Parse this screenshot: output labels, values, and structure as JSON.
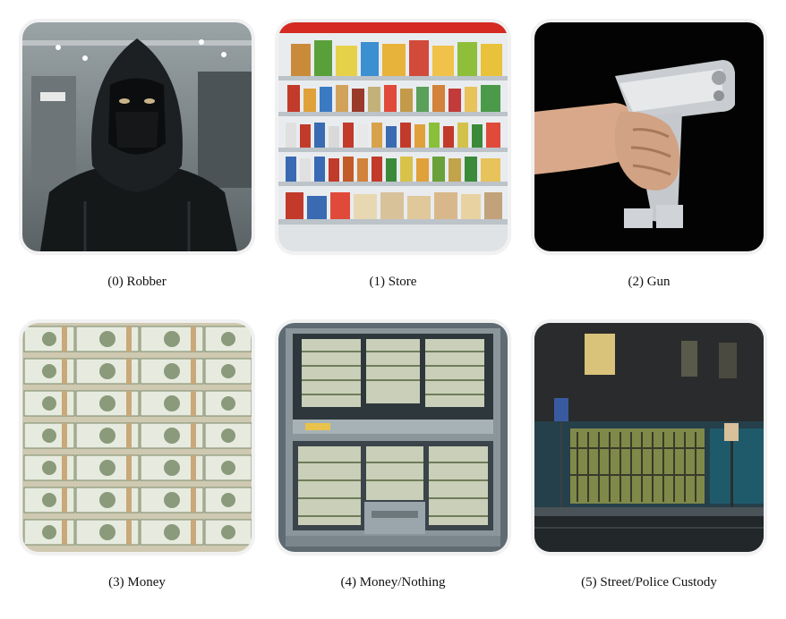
{
  "tiles": [
    {
      "label": "(0) Robber",
      "image": "hooded-robber-image"
    },
    {
      "label": "(1) Store",
      "image": "store-shelves-image"
    },
    {
      "label": "(2) Gun",
      "image": "handgun-image"
    },
    {
      "label": "(3) Money",
      "image": "money-stacks-image"
    },
    {
      "label": "(4) Money/Nothing",
      "image": "cash-drawer-image"
    },
    {
      "label": "(5) Street/Police Custody",
      "image": "street-jail-image"
    }
  ]
}
